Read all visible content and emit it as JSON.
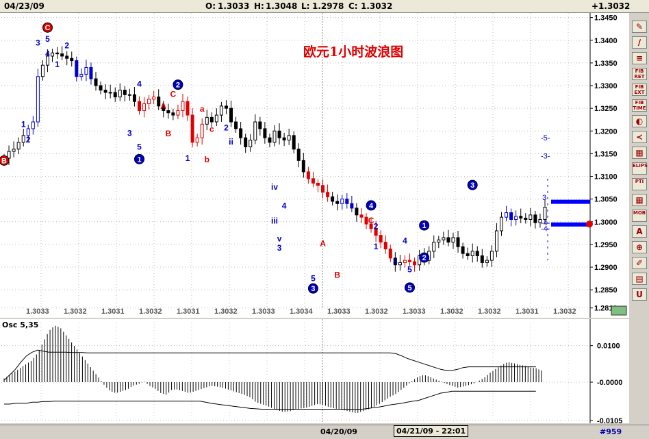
{
  "header": {
    "date": "04/23/09",
    "open_label": "O:",
    "open": "1.3033",
    "high_label": "H:",
    "high": "1.3048",
    "low_label": "L:",
    "low": "1.2978",
    "close_label": "C:",
    "close": "1.3032",
    "change": "+1.3032"
  },
  "chart_title": "欧元1小时波浪图",
  "osc_label": "Osc 5,35",
  "colors": {
    "up": "#000000",
    "down_red": "#e00000",
    "wave_blue": "#0000cc",
    "osc": "#000000",
    "band": "#0000ff"
  },
  "toolbar": {
    "buttons": [
      "✎",
      "∕",
      "≡",
      "FIB RET",
      "FIB EXT",
      "FIB TIME",
      "◐",
      "≺",
      "▦",
      "ELIPS",
      "PTI",
      "▦",
      "MOB",
      "A",
      "⊕",
      "✐",
      "▤",
      "U"
    ]
  },
  "status": {
    "date_left": "04/20/09",
    "date_right": "04/21/09 - 22:01",
    "count": "#959"
  },
  "chart_data": [
    {
      "type": "candlestick",
      "y_ticks": [
        1.345,
        1.34,
        1.335,
        1.33,
        1.325,
        1.32,
        1.315,
        1.31,
        1.305,
        1.3,
        1.295,
        1.29,
        1.285,
        1.281
      ],
      "y_tick_labels": [
        "1.3450",
        "1.3400",
        "1.3350",
        "1.3300",
        "1.3250",
        "1.3200",
        "1.3150",
        "1.3100",
        "1.3050",
        "1.3000",
        "1.2950",
        "1.2900",
        "1.2850",
        "1.2810"
      ],
      "ylim": [
        1.2811,
        1.346
      ],
      "x_labels": [
        "1.3033",
        "1.3032",
        "1.3031",
        "1.3032",
        "1.3031",
        "1.3032",
        "1.3033",
        "1.3034",
        "1.3033",
        "1.3032",
        "1.3033",
        "1.3032",
        "1.3032",
        "1.3031",
        "1.3032"
      ],
      "closes": [
        1.314,
        1.3155,
        1.316,
        1.3175,
        1.319,
        1.3205,
        1.322,
        1.332,
        1.3345,
        1.3365,
        1.3372,
        1.337,
        1.3365,
        1.336,
        1.3355,
        1.332,
        1.3325,
        1.334,
        1.3315,
        1.33,
        1.329,
        1.3285,
        1.3285,
        1.3275,
        1.329,
        1.328,
        1.328,
        1.3265,
        1.3245,
        1.326,
        1.327,
        1.3275,
        1.3255,
        1.3245,
        1.324,
        1.3235,
        1.3245,
        1.3265,
        1.3235,
        1.3175,
        1.3185,
        1.3215,
        1.323,
        1.322,
        1.3235,
        1.3255,
        1.325,
        1.322,
        1.3205,
        1.3185,
        1.3165,
        1.318,
        1.322,
        1.3205,
        1.3185,
        1.3175,
        1.32,
        1.3185,
        1.318,
        1.319,
        1.316,
        1.3135,
        1.311,
        1.3095,
        1.3085,
        1.308,
        1.3065,
        1.3055,
        1.3045,
        1.304,
        1.305,
        1.304,
        1.303,
        1.3015,
        1.301,
        1.2995,
        1.2985,
        1.297,
        1.2955,
        1.294,
        1.292,
        1.2905,
        1.291,
        1.2915,
        1.2912,
        1.2905,
        1.2925,
        1.2915,
        1.2935,
        1.2955,
        1.296,
        1.2965,
        1.2955,
        1.2965,
        1.2945,
        1.293,
        1.2925,
        1.2935,
        1.2925,
        1.291,
        1.2915,
        1.2935,
        1.298,
        1.301,
        1.302,
        1.3005,
        1.3012,
        1.3008,
        1.3005,
        1.3015,
        1.2998,
        1.3005,
        1.3032
      ],
      "red_segments": [
        [
          28,
          31
        ],
        [
          36,
          41
        ],
        [
          63,
          67
        ],
        [
          74,
          80
        ],
        [
          83,
          85
        ]
      ],
      "blue_segments": [
        [
          5,
          7
        ],
        [
          15,
          18
        ],
        [
          64,
          66
        ],
        [
          70,
          72
        ],
        [
          104,
          106
        ]
      ],
      "labels": [
        {
          "t": "C",
          "i": 9,
          "y": 1.3428,
          "c": "red",
          "circle": true
        },
        {
          "t": "5",
          "i": 9,
          "y": 1.3403
        },
        {
          "t": "3",
          "i": 7,
          "y": 1.3394
        },
        {
          "t": "4",
          "i": 9,
          "y": 1.337
        },
        {
          "t": "2",
          "i": 13,
          "y": 1.3388
        },
        {
          "t": "1",
          "i": 11,
          "y": 1.3347
        },
        {
          "t": "1",
          "i": 4,
          "y": 1.3215
        },
        {
          "t": "2",
          "i": 5,
          "y": 1.3181
        },
        {
          "t": "B",
          "i": 0,
          "y": 1.3135,
          "c": "red",
          "circle": true
        },
        {
          "t": "3",
          "i": 26,
          "y": 1.3195
        },
        {
          "t": "4",
          "i": 28,
          "y": 1.3304
        },
        {
          "t": "5",
          "i": 28,
          "y": 1.3165
        },
        {
          "t": "1",
          "i": 28,
          "y": 1.3138,
          "circle": true
        },
        {
          "t": "A",
          "i": 33,
          "y": 1.3255,
          "c": "red"
        },
        {
          "t": "B",
          "i": 34,
          "y": 1.3194,
          "c": "red"
        },
        {
          "t": "C",
          "i": 35,
          "y": 1.3281,
          "c": "red"
        },
        {
          "t": "2",
          "i": 36,
          "y": 1.3302,
          "circle": true
        },
        {
          "t": "a",
          "i": 41,
          "y": 1.3249,
          "c": "red"
        },
        {
          "t": "c",
          "i": 43,
          "y": 1.3204,
          "c": "red"
        },
        {
          "t": "b",
          "i": 42,
          "y": 1.3137,
          "c": "red"
        },
        {
          "t": "1",
          "i": 38,
          "y": 1.314
        },
        {
          "t": "2",
          "i": 46,
          "y": 1.3207
        },
        {
          "t": "ii",
          "i": 47,
          "y": 1.3176
        },
        {
          "t": "iv",
          "i": 56,
          "y": 1.3077
        },
        {
          "t": "iii",
          "i": 56,
          "y": 1.3002
        },
        {
          "t": "4",
          "i": 58,
          "y": 1.3035
        },
        {
          "t": "v",
          "i": 57,
          "y": 1.2963
        },
        {
          "t": "3",
          "i": 57,
          "y": 1.2942
        },
        {
          "t": "A",
          "i": 66,
          "y": 1.2952,
          "c": "red"
        },
        {
          "t": "B",
          "i": 69,
          "y": 1.2883,
          "c": "red"
        },
        {
          "t": "5",
          "i": 64,
          "y": 1.2875
        },
        {
          "t": "3",
          "i": 64,
          "y": 1.2853,
          "circle": true
        },
        {
          "t": "4",
          "i": 76,
          "y": 1.3036,
          "circle": true
        },
        {
          "t": "C",
          "i": 76,
          "y": 1.3003,
          "c": "red"
        },
        {
          "t": "2",
          "i": 77,
          "y": 1.299
        },
        {
          "t": "1",
          "i": 77,
          "y": 1.2945
        },
        {
          "t": "3",
          "i": 81,
          "y": 1.2912
        },
        {
          "t": "4",
          "i": 83,
          "y": 1.2958
        },
        {
          "t": "5",
          "i": 84,
          "y": 1.2895
        },
        {
          "t": "5",
          "i": 84,
          "y": 1.2855,
          "circle": true
        },
        {
          "t": "1",
          "i": 87,
          "y": 1.2992,
          "circle": true
        },
        {
          "t": "2",
          "i": 87,
          "y": 1.2921,
          "circle": true
        },
        {
          "t": "3",
          "i": 97,
          "y": 1.3081,
          "circle": true
        }
      ],
      "projection_labels": [
        "-5-",
        "-3-",
        "3",
        "-4-",
        "-4-"
      ],
      "projection_values": [
        1.3185,
        1.3145,
        1.3054,
        1.2998,
        1.2985
      ],
      "bands": [
        1.3044,
        1.2994
      ]
    },
    {
      "type": "histogram_line",
      "title": "Osc 5,35",
      "y_tick_labels": [
        "0.0100",
        "-0.0000",
        "-0.0105"
      ],
      "y_ticks": [
        0.01,
        0.0,
        -0.0105
      ],
      "ylim": [
        -0.0105,
        0.0165
      ],
      "values": [
        0.001,
        0.002,
        0.003,
        0.004,
        0.005,
        0.006,
        0.008,
        0.011,
        0.014,
        0.0155,
        0.015,
        0.013,
        0.011,
        0.009,
        0.007,
        0.005,
        0.003,
        0.001,
        -0.001,
        -0.0025,
        -0.003,
        -0.0025,
        -0.002,
        -0.001,
        -0.0005,
        0.0002,
        -0.001,
        -0.0018,
        -0.003,
        -0.0035,
        -0.002,
        -0.002,
        -0.0025,
        -0.003,
        -0.0025,
        -0.002,
        -0.0015,
        -0.001,
        -0.0012,
        -0.0015,
        -0.002,
        -0.0025,
        -0.003,
        -0.0035,
        -0.0042,
        -0.0055,
        -0.006,
        -0.0065,
        -0.0072,
        -0.0078,
        -0.0082,
        -0.008,
        -0.0075,
        -0.0072,
        -0.007,
        -0.0065,
        -0.006,
        -0.0062,
        -0.0068,
        -0.0072,
        -0.0075,
        -0.0078,
        -0.0082,
        -0.0085,
        -0.008,
        -0.0075,
        -0.0068,
        -0.006,
        -0.005,
        -0.004,
        -0.0032,
        -0.002,
        -0.0008,
        0.0005,
        0.0015,
        0.002,
        0.0015,
        0.0008,
        0.0002,
        -0.0005,
        -0.001,
        -0.0015,
        -0.0012,
        -0.0008,
        -0.0003,
        0.0005,
        0.0015,
        0.0028,
        0.0038,
        0.0048,
        0.0055,
        0.0052,
        0.0048,
        0.0045,
        0.004,
        0.0038,
        0.0032
      ],
      "band_upper": [
        0.0005,
        0.002,
        0.0035,
        0.0055,
        0.0072,
        0.0082,
        0.0088,
        0.0085,
        0.0082,
        0.0082,
        0.0082,
        0.0082,
        0.0081,
        0.0081,
        0.0081,
        0.008,
        0.008,
        0.008,
        0.008,
        0.008,
        0.008,
        0.008,
        0.008,
        0.008,
        0.008,
        0.008,
        0.008,
        0.008,
        0.008,
        0.008,
        0.008,
        0.008,
        0.008,
        0.008,
        0.008,
        0.008,
        0.008,
        0.008,
        0.008,
        0.008,
        0.008,
        0.008,
        0.008,
        0.008,
        0.008,
        0.008,
        0.008,
        0.008,
        0.008,
        0.008,
        0.008,
        0.008,
        0.008,
        0.008,
        0.008,
        0.008,
        0.008,
        0.008,
        0.008,
        0.008,
        0.008,
        0.008,
        0.008,
        0.008,
        0.008,
        0.008,
        0.008,
        0.008,
        0.008,
        0.008,
        0.0078,
        0.0072,
        0.0065,
        0.006,
        0.0055,
        0.005,
        0.0045,
        0.004,
        0.0035,
        0.0032,
        0.0032,
        0.0035,
        0.004,
        0.0042,
        0.0042,
        0.0042,
        0.0042,
        0.0042,
        0.0042,
        0.0042,
        0.0042,
        0.0042,
        0.0042,
        0.0042,
        0.0042,
        0.0042
      ],
      "band_lower": [
        -0.006,
        -0.006,
        -0.0058,
        -0.0058,
        -0.0058,
        -0.0055,
        -0.0055,
        -0.0053,
        -0.0053,
        -0.0052,
        -0.0052,
        -0.0052,
        -0.0052,
        -0.0052,
        -0.0052,
        -0.0052,
        -0.0052,
        -0.0052,
        -0.0052,
        -0.0052,
        -0.0052,
        -0.0052,
        -0.0052,
        -0.0052,
        -0.0052,
        -0.0052,
        -0.0052,
        -0.0052,
        -0.0052,
        -0.0052,
        -0.0052,
        -0.0052,
        -0.0052,
        -0.0052,
        -0.0052,
        -0.0052,
        -0.0055,
        -0.0058,
        -0.006,
        -0.0062,
        -0.0064,
        -0.0066,
        -0.0068,
        -0.007,
        -0.0072,
        -0.0073,
        -0.0074,
        -0.0074,
        -0.0074,
        -0.0074,
        -0.0074,
        -0.0074,
        -0.0074,
        -0.0074,
        -0.0074,
        -0.0074,
        -0.0074,
        -0.0074,
        -0.0074,
        -0.0074,
        -0.0074,
        -0.0074,
        -0.0074,
        -0.0074,
        -0.0074,
        -0.0072,
        -0.007,
        -0.0068,
        -0.0065,
        -0.0062,
        -0.006,
        -0.0058,
        -0.0055,
        -0.0052,
        -0.005,
        -0.0045,
        -0.004,
        -0.0035,
        -0.003,
        -0.0028,
        -0.0025,
        -0.0025,
        -0.0025,
        -0.0025,
        -0.0025,
        -0.0025,
        -0.0025,
        -0.0025,
        -0.0025,
        -0.0025,
        -0.0025,
        -0.0025,
        -0.0025,
        -0.0025,
        -0.0025,
        -0.0025
      ]
    }
  ]
}
